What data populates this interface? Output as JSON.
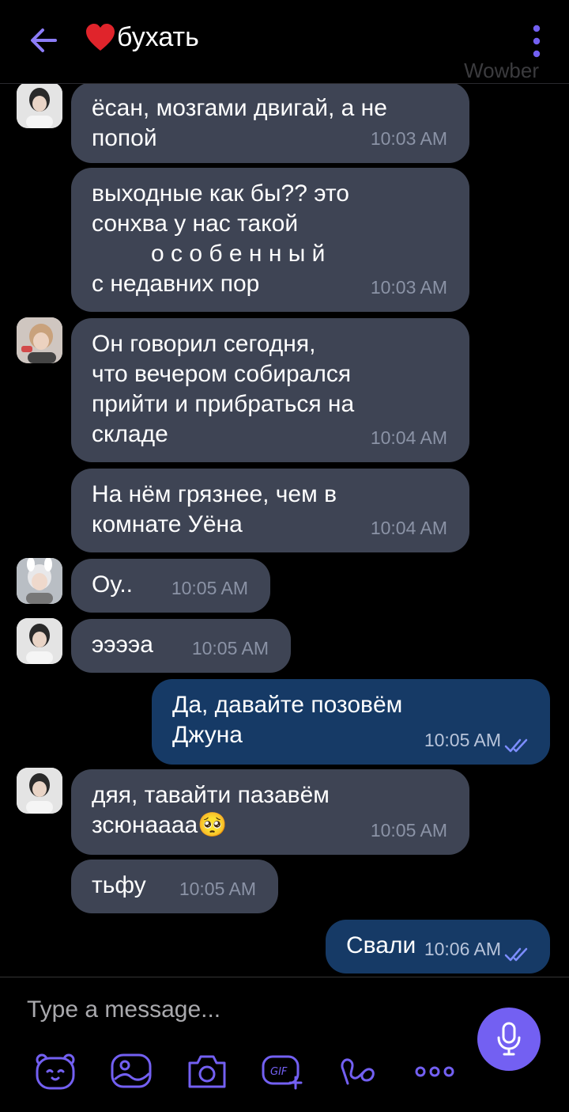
{
  "header": {
    "title": "бухать",
    "watermark": "Wowber"
  },
  "messages": [
    {
      "text": "ёсан, мозгами двигай, а не\nпопой",
      "time": "10:03 AM"
    },
    {
      "text": "выходные как бы?? это\nсонхва у нас такой\n         о с о б е н н ы й\nс недавних пор",
      "time": "10:03 AM"
    },
    {
      "text": "Он говорил сегодня,\nчто вечером собирался\nприйти и прибраться на\nскладе",
      "time": "10:04 AM"
    },
    {
      "text": "На нём грязнее, чем в\nкомнате Уёна",
      "time": "10:04 AM"
    },
    {
      "text": "Оу..",
      "time": "10:05 AM"
    },
    {
      "text": "ээээа",
      "time": "10:05 AM"
    },
    {
      "text": "Да, давайте позовём\nДжуна",
      "time": "10:05 AM"
    },
    {
      "text": "дяя, тавайти пазавём\nзсюнаааа🥺",
      "time": "10:05 AM"
    },
    {
      "text": "тьфу",
      "time": "10:05 AM"
    },
    {
      "text": "Свали",
      "time": "10:06 AM"
    }
  ],
  "composer": {
    "placeholder": "Type a message..."
  },
  "colors": {
    "incoming": "#3e4454",
    "outgoing": "#163a66",
    "accent": "#7360f2"
  },
  "icons": [
    "back-arrow-icon",
    "heart-icon",
    "more-vert-icon",
    "sticker-bear-icon",
    "image-icon",
    "camera-icon",
    "gif-icon",
    "doodle-icon",
    "more-icon",
    "microphone-icon",
    "read-ticks-icon"
  ]
}
